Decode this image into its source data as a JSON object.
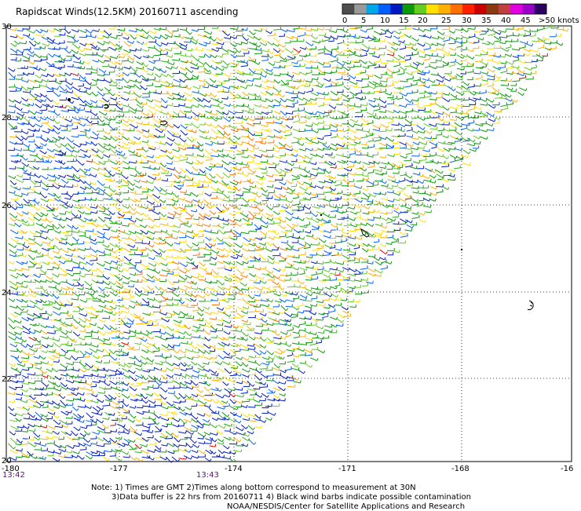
{
  "title": "Rapidscat Winds(12.5KM) 20160711 ascending",
  "legend": {
    "colors": [
      "#4d4d4d",
      "#9a9a9a",
      "#00a8e8",
      "#0060ff",
      "#0018c0",
      "#0a9a0a",
      "#66cc22",
      "#ffe000",
      "#ffb000",
      "#ff7000",
      "#ff2000",
      "#c80000",
      "#8a3a10",
      "#c04040",
      "#e000e0",
      "#9a00c8",
      "#2a0060"
    ],
    "ticks": [
      "0",
      "5",
      "10",
      "15",
      "20",
      "25",
      "30",
      "35",
      "40",
      "45",
      ">50 knots"
    ]
  },
  "axes": {
    "x_ticks": [
      "-180",
      "-177",
      "-174",
      "-171",
      "-168",
      "-16"
    ],
    "y_ticks": [
      "30",
      "28",
      "26",
      "24",
      "22",
      "20"
    ]
  },
  "times": {
    "left": "13:42",
    "mid": "13:43"
  },
  "notes": {
    "line1": "Note: 1) Times are GMT 2)Times along bottom correspond to measurement at 30N",
    "line2": "3)Data buffer is 22 hrs from 20160711 4) Black wind barbs indicate possible contamination",
    "line3": "NOAA/NESDIS/Center for Satellite Applications and Research"
  }
}
